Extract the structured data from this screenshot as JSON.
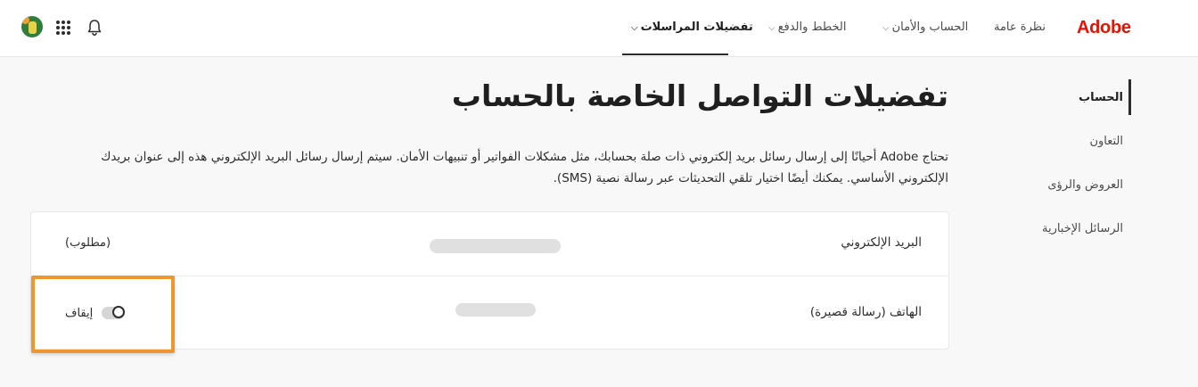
{
  "header": {
    "logo": "Adobe",
    "nav": [
      {
        "label": "نظرة عامة",
        "has_dropdown": false
      },
      {
        "label": "الحساب والأمان",
        "has_dropdown": true
      },
      {
        "label": "الخطط والدفع",
        "has_dropdown": true
      },
      {
        "label": "تفضيلات المراسلات",
        "has_dropdown": true,
        "active": true
      }
    ],
    "icons": [
      "avatar",
      "apps-grid-icon",
      "bell-icon"
    ]
  },
  "sidebar": {
    "items": [
      {
        "label": "الحساب",
        "active": true
      },
      {
        "label": "التعاون"
      },
      {
        "label": "العروض والرؤى"
      },
      {
        "label": "الرسائل الإخبارية"
      }
    ]
  },
  "main": {
    "title": "تفضيلات التواصل الخاصة بالحساب",
    "intro": "تحتاج Adobe أحيانًا إلى إرسال رسائل بريد إلكتروني ذات صلة بحسابك، مثل مشكلات الفواتير أو تنبيهات الأمان. سيتم إرسال رسائل البريد الإلكتروني هذه إلى عنوان بريدك الإلكتروني الأساسي. يمكنك أيضًا اختيار تلقي التحديثات عبر رسالة نصية (SMS).",
    "rows": [
      {
        "label": "البريد الإلكتروني",
        "status": "(مطلوب)"
      },
      {
        "label": "الهاتف (رسالة قصيرة)",
        "toggle_label": "إيقاف",
        "toggle_on": false
      }
    ]
  },
  "colors": {
    "brand": "#eb1000",
    "highlight": "#f0962e",
    "background": "#f8f8f8"
  }
}
